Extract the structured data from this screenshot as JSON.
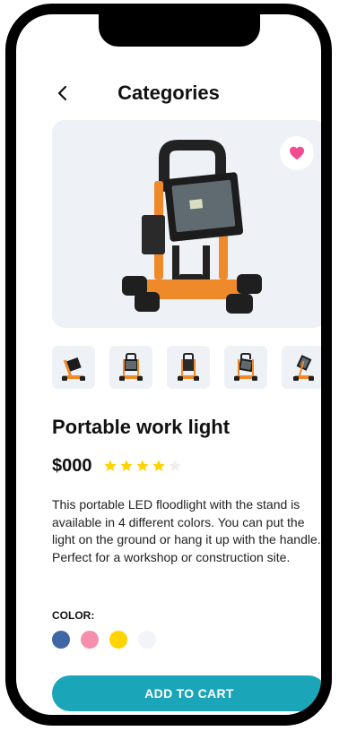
{
  "header": {
    "title": "Categories",
    "back_icon": "chevron-left-icon"
  },
  "hero": {
    "favorite_icon": "heart-icon",
    "favorite_color": "#f24b8f",
    "background_color": "#eef2f7"
  },
  "thumbnails": [
    {
      "name": "work light view 1"
    },
    {
      "name": "work light view 2"
    },
    {
      "name": "work light view 3"
    },
    {
      "name": "work light view 4"
    },
    {
      "name": "work light view 5"
    }
  ],
  "product": {
    "name": "Portable work light",
    "price": "$000",
    "rating": 4,
    "rating_max": 5,
    "star_color": "#ffd400",
    "star_empty_color": "#eeeeee",
    "description": "This portable LED floodlight with the stand is available in 4 different colors. You can put the light on the ground or hang it up with the handle. Perfect for a workshop or construction site."
  },
  "colors": {
    "label": "COLOR:",
    "options": [
      "#3f67a6",
      "#f68fac",
      "#ffd400",
      "#f1f4f8"
    ]
  },
  "cart": {
    "label": "ADD TO CART",
    "color": "#1aa6b8"
  }
}
